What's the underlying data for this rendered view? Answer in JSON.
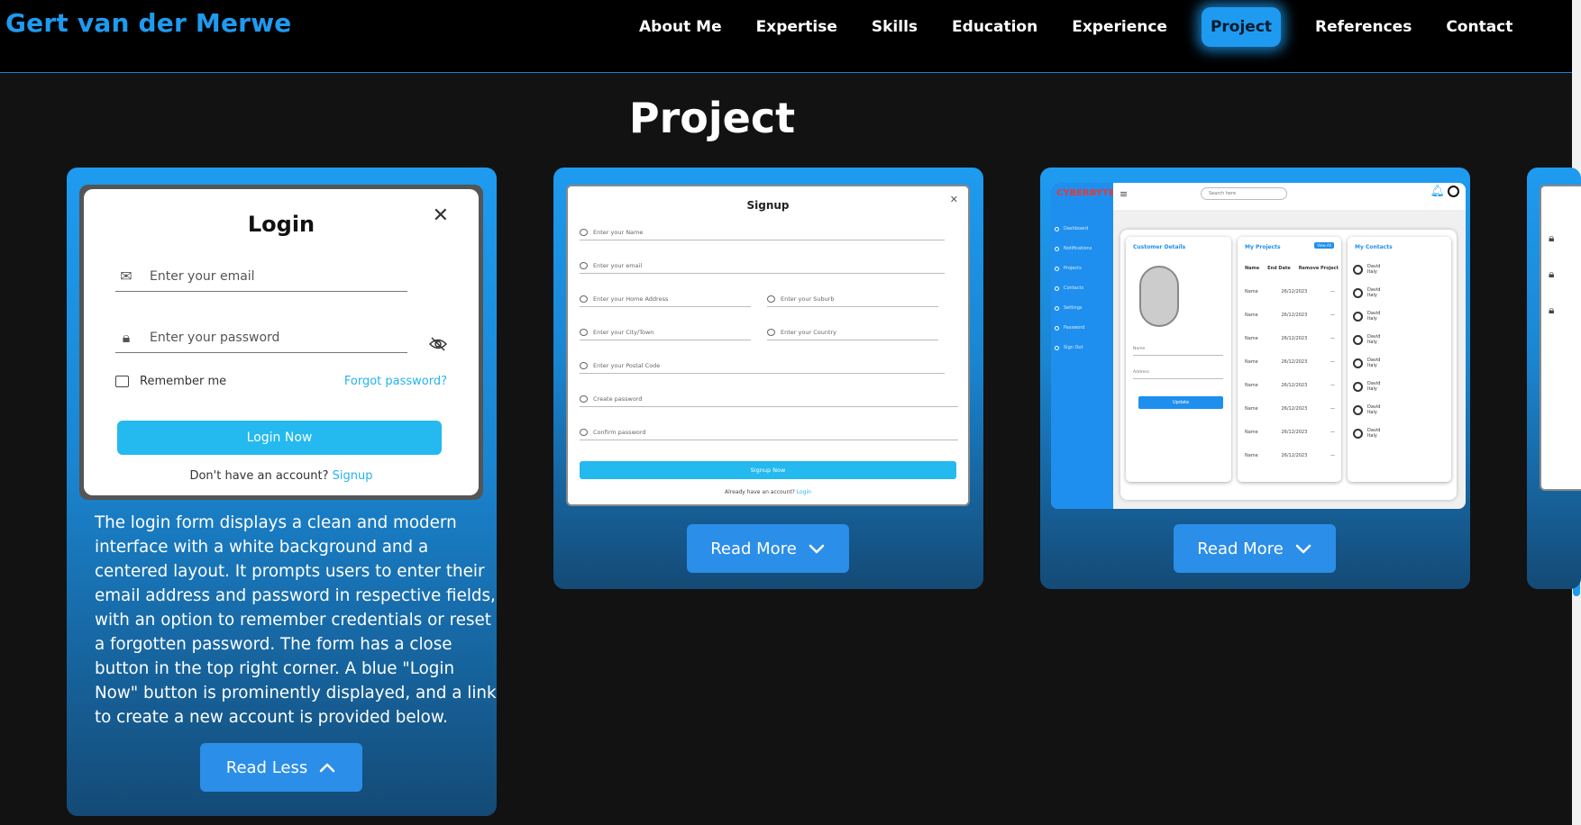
{
  "header": {
    "brand": "Gert van der Merwe",
    "nav": [
      {
        "label": "About Me",
        "active": false
      },
      {
        "label": "Expertise",
        "active": false
      },
      {
        "label": "Skills",
        "active": false
      },
      {
        "label": "Education",
        "active": false
      },
      {
        "label": "Experience",
        "active": false
      },
      {
        "label": "Project",
        "active": true
      },
      {
        "label": "References",
        "active": false
      },
      {
        "label": "Contact",
        "active": false
      }
    ]
  },
  "section": {
    "title": "Project"
  },
  "colors": {
    "accent": "#1e9bf0",
    "background": "#121212",
    "header_bg": "#000000"
  },
  "projects": [
    {
      "name": "login",
      "preview": {
        "title": "Login",
        "email_placeholder": "Enter your email",
        "password_placeholder": "Enter your password",
        "remember": "Remember me",
        "forgot": "Forgot password?",
        "button": "Login Now",
        "no_account": "Don't have an account?",
        "signup_link": "Signup"
      },
      "description": "The login form displays a clean and modern interface with a white background and a centered layout. It prompts users to enter their email address and password in respective fields, with an option to remember credentials or reset a forgotten password. The form has a close button in the top right corner. A blue \"Login Now\" button is prominently displayed, and a link to create a new account is provided below.",
      "toggle_label": "Read Less",
      "expanded": true
    },
    {
      "name": "signup",
      "preview": {
        "title": "Signup",
        "fields": [
          "Enter your Name",
          "Enter your email",
          "Enter your Home Address",
          "Enter your Suburb",
          "Enter your City/Town",
          "Enter your Country",
          "Enter your Postal Code",
          "Create password",
          "Confirm password"
        ],
        "button": "Signup Now",
        "have_account": "Already have an account?",
        "login_link": "Login"
      },
      "toggle_label": "Read More",
      "expanded": false
    },
    {
      "name": "dashboard",
      "preview": {
        "logo": "CYBERBYTE",
        "search_placeholder": "Search here",
        "sidebar": [
          "Dashboard",
          "Notifications",
          "Projects",
          "Contacts",
          "Settings",
          "Password",
          "Sign Out"
        ],
        "customer_panel": "Customer Details",
        "customer_fields": [
          "Name",
          "Address"
        ],
        "update_button": "Update",
        "projects_panel": "My Projects",
        "view_all": "View All",
        "projects_columns": [
          "Name",
          "End Date",
          "Remove Project"
        ],
        "project_rows": [
          {
            "name": "Name",
            "date": "26/12/2023",
            "remove": "—"
          },
          {
            "name": "Name",
            "date": "26/12/2023",
            "remove": "—"
          },
          {
            "name": "Name",
            "date": "26/12/2023",
            "remove": "—"
          },
          {
            "name": "Name",
            "date": "26/12/2023",
            "remove": "—"
          },
          {
            "name": "Name",
            "date": "26/12/2023",
            "remove": "—"
          },
          {
            "name": "Name",
            "date": "26/12/2023",
            "remove": "—"
          },
          {
            "name": "Name",
            "date": "26/12/2023",
            "remove": "—"
          },
          {
            "name": "Name",
            "date": "26/12/2023",
            "remove": "—"
          }
        ],
        "contacts_panel": "My Contacts",
        "contacts": [
          {
            "name": "David",
            "country": "Italy"
          },
          {
            "name": "David",
            "country": "Italy"
          },
          {
            "name": "David",
            "country": "Italy"
          },
          {
            "name": "David",
            "country": "Italy"
          },
          {
            "name": "David",
            "country": "Italy"
          },
          {
            "name": "David",
            "country": "Italy"
          },
          {
            "name": "David",
            "country": "Italy"
          },
          {
            "name": "David",
            "country": "Italy"
          }
        ]
      },
      "toggle_label": "Read More",
      "expanded": false
    }
  ]
}
